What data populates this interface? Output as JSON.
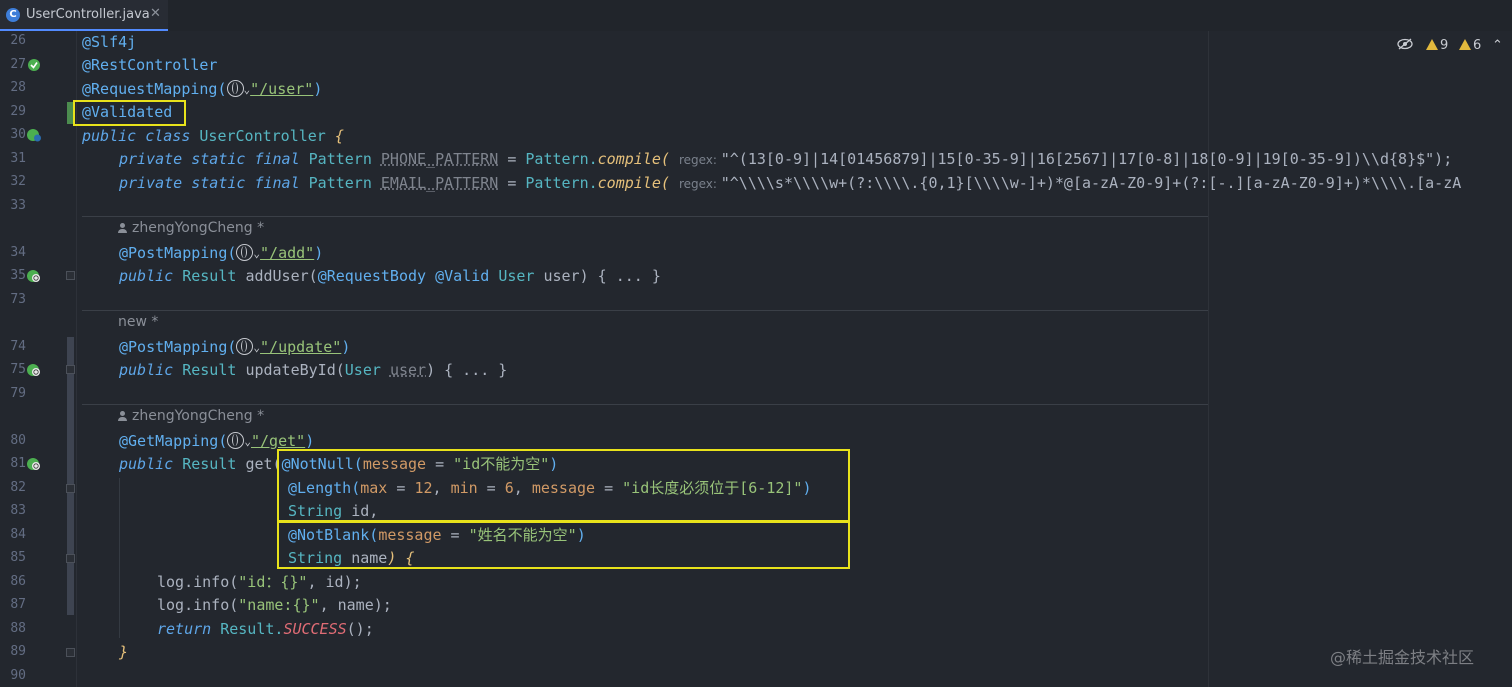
{
  "tab": {
    "label": "UserController.java",
    "close": "✕",
    "icon_letter": "C"
  },
  "inspections": {
    "warnings": "9",
    "weak_warnings": "6"
  },
  "watermark": "@稀土掘金技术社区",
  "lines": {
    "l26": "26",
    "l27": "27",
    "l28": "28",
    "l29": "29",
    "l30": "30",
    "l31": "31",
    "l32": "32",
    "l33": "33",
    "l34": "34",
    "l35": "35",
    "l73": "73",
    "l74": "74",
    "l75": "75",
    "l79": "79",
    "l80": "80",
    "l81": "81",
    "l82": "82",
    "l83": "83",
    "l84": "84",
    "l85": "85",
    "l86": "86",
    "l87": "87",
    "l88": "88",
    "l89": "89",
    "l90": "90"
  },
  "authors": {
    "a1": "zhengYongCheng *",
    "a2": "new *",
    "a3": "zhengYongCheng *"
  },
  "code": {
    "slf4j": "@Slf4j",
    "rest": "@RestController",
    "reqmap": "@RequestMapping(",
    "reqmap_url": "\"/user\"",
    "close_paren": ")",
    "validated": "@Validated",
    "public_class": "public class ",
    "class_name": "UserController",
    "brace_open": " {",
    "pss_final": "private static final ",
    "pattern_type": "Pattern ",
    "phone_field": "PHONE_PATTERN",
    "email_field": "EMAIL_PATTERN",
    "assign": " = ",
    "pattern_cls": "Pattern.",
    "compile": "compile",
    "open_paren": "( ",
    "regex_hint": "regex: ",
    "phone_regex": "\"^(13[0-9]|14[01456879]|15[0-35-9]|16[2567]|17[0-8]|18[0-9]|19[0-35-9])\\\\d{8}$\");",
    "email_regex": "\"^\\\\\\\\s*\\\\\\\\w+(?:\\\\\\\\.{0,1}[\\\\\\\\w-]+)*@[a-zA-Z0-9]+(?:[-.][a-zA-Z0-9]+)*\\\\\\\\.[a-zA",
    "postmap": "@PostMapping(",
    "add_url": "\"/add\"",
    "public_result": "public ",
    "result_type": "Result ",
    "add_user": "addUser(",
    "reqbody": "@RequestBody ",
    "valid": "@Valid ",
    "user_type": "User ",
    "user_param": "user",
    "folded_tail": ") { ... }",
    "update_url": "\"/update\"",
    "update_by_id": "updateById(",
    "getmap": "@GetMapping(",
    "get_url": "\"/get\"",
    "get_name": "get(",
    "notnull": "@NotNull(",
    "message_kw": "message",
    "eq": " = ",
    "id_notnull_msg": "\"id不能为空\"",
    "length": "@Length(",
    "max_kw": "max",
    "max_val": "12",
    "comma_sp": ", ",
    "min_kw": "min",
    "min_val": "6",
    "id_len_msg": "\"id长度必须位于[6-12]\"",
    "string_type": "String ",
    "id_param": "id,",
    "notblank": "@NotBlank(",
    "name_msg": "\"姓名不能为空\"",
    "name_param": "name",
    "name_tail": ") {",
    "log_info": "log.info(",
    "log_id_fmt": "\"id：{}\"",
    "log_id_args": ", id);",
    "log_name_fmt": "\"name:{}\"",
    "log_name_args": ", name);",
    "return_kw": "return ",
    "result_cls": "Result.",
    "success": "SUCCESS",
    "success_tail": "();",
    "close_brace": "}"
  }
}
